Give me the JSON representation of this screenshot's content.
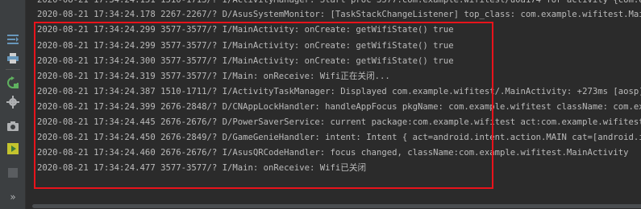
{
  "toolbar": {
    "items": [
      {
        "icon": "scroll-to-end-icon"
      },
      {
        "icon": "print-icon"
      },
      {
        "icon": "restart-icon"
      },
      {
        "icon": "settings-icon"
      },
      {
        "icon": "screenshot-icon"
      },
      {
        "icon": "screen-record-icon"
      },
      {
        "icon": "stop-icon"
      }
    ],
    "more_label": "»"
  },
  "log_lines": [
    "2020-08-21 17:34:24.151 1510-1713/? I/ActivityManager: Start proc 3577:com.example.wifitest/u0a174 for activity {com.example.",
    "2020-08-21 17:34:24.178 2267-2267/? D/AsusSystemMonitor: [TaskStackChangeListener] top_class: com.example.wifitest.MainActiv",
    "2020-08-21 17:34:24.299 3577-3577/? I/MainActivity: onCreate: getWifiState() true",
    "2020-08-21 17:34:24.299 3577-3577/? I/MainActivity: onCreate: getWifiState() true",
    "2020-08-21 17:34:24.300 3577-3577/? I/MainActivity: onCreate: getWifiState() true",
    "2020-08-21 17:34:24.319 3577-3577/? I/Main: onReceive: Wifi正在关闭...",
    "2020-08-21 17:34:24.387 1510-1711/? I/ActivityTaskManager: Displayed com.example.wifitest/.MainActivity: +273ms [aosp]",
    "2020-08-21 17:34:24.399 2676-2848/? D/CNAppLockHandler: handleAppFocus pkgName: com.example.wifitest className: com.example.w",
    "2020-08-21 17:34:24.445 2676-2676/? D/PowerSaverService: current package:com.example.wifitest act:com.example.wifitest.MainAc",
    "2020-08-21 17:34:24.450 2676-2849/? D/GameGenieHandler: intent: Intent { act=android.intent.action.MAIN cat=[android.intent.c",
    "2020-08-21 17:34:24.460 2676-2676/? I/AsusQRCodeHandler: focus changed, className:com.example.wifitest.MainActivity",
    "2020-08-21 17:34:24.477 3577-3577/? I/Main: onReceive: Wifi已关闭"
  ],
  "colors": {
    "background": "#2b2b2b",
    "text": "#bbbbbb",
    "highlight_border": "#e8131b",
    "toolbar": "#3c3f41"
  }
}
